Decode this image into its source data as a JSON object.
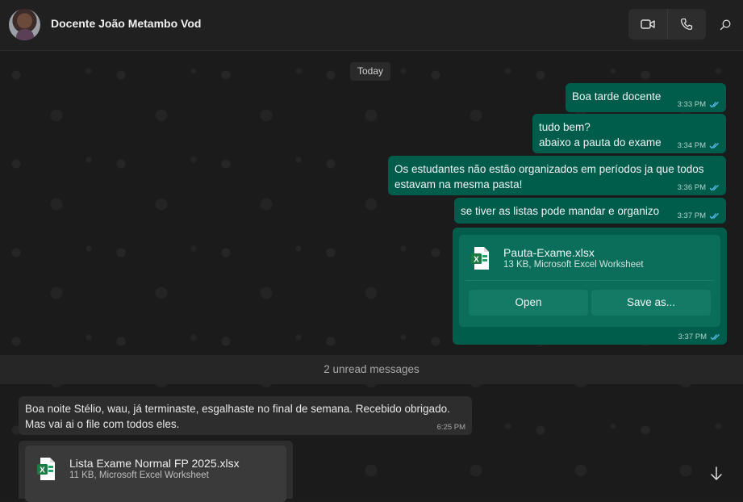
{
  "header": {
    "contact_name": "Docente João Metambo Vod"
  },
  "chat": {
    "date_chip": "Today",
    "outgoing": [
      {
        "text": "Boa tarde docente",
        "time": "3:33 PM"
      },
      {
        "text": "tudo bem?\nabaixo a pauta do exame",
        "time": "3:34 PM"
      },
      {
        "text": "Os estudantes não estão organizados em períodos ja que todos\nestavam na mesma pasta!",
        "time": "3:36 PM"
      },
      {
        "text": "se tiver as listas pode mandar e organizo",
        "time": "3:37 PM"
      }
    ],
    "outgoing_file": {
      "name": "Pauta-Exame.xlsx",
      "details": "13 KB, Microsoft Excel Worksheet",
      "open_label": "Open",
      "save_label": "Save as...",
      "time": "3:37 PM"
    },
    "unread_label": "2 unread messages",
    "incoming": {
      "text": "Boa noite Stélio, wau, já terminaste, esgalhaste no final de semana. Recebido obrigado.\nMas vai ai o file com todos eles.",
      "time": "6:25 PM"
    },
    "incoming_file": {
      "name": "Lista Exame Normal FP 2025.xlsx",
      "details": "11 KB, Microsoft Excel Worksheet"
    }
  },
  "colors": {
    "outgoing_bubble": "#005c4b",
    "incoming_bubble": "#2d2d2d",
    "read_tick": "#53bdeb",
    "excel_green": "#1d7a43"
  },
  "icons": {
    "video": "video-call-icon",
    "voice": "voice-call-icon",
    "search": "search-icon",
    "file": "excel-file-icon",
    "scroll": "arrow-down-icon"
  }
}
